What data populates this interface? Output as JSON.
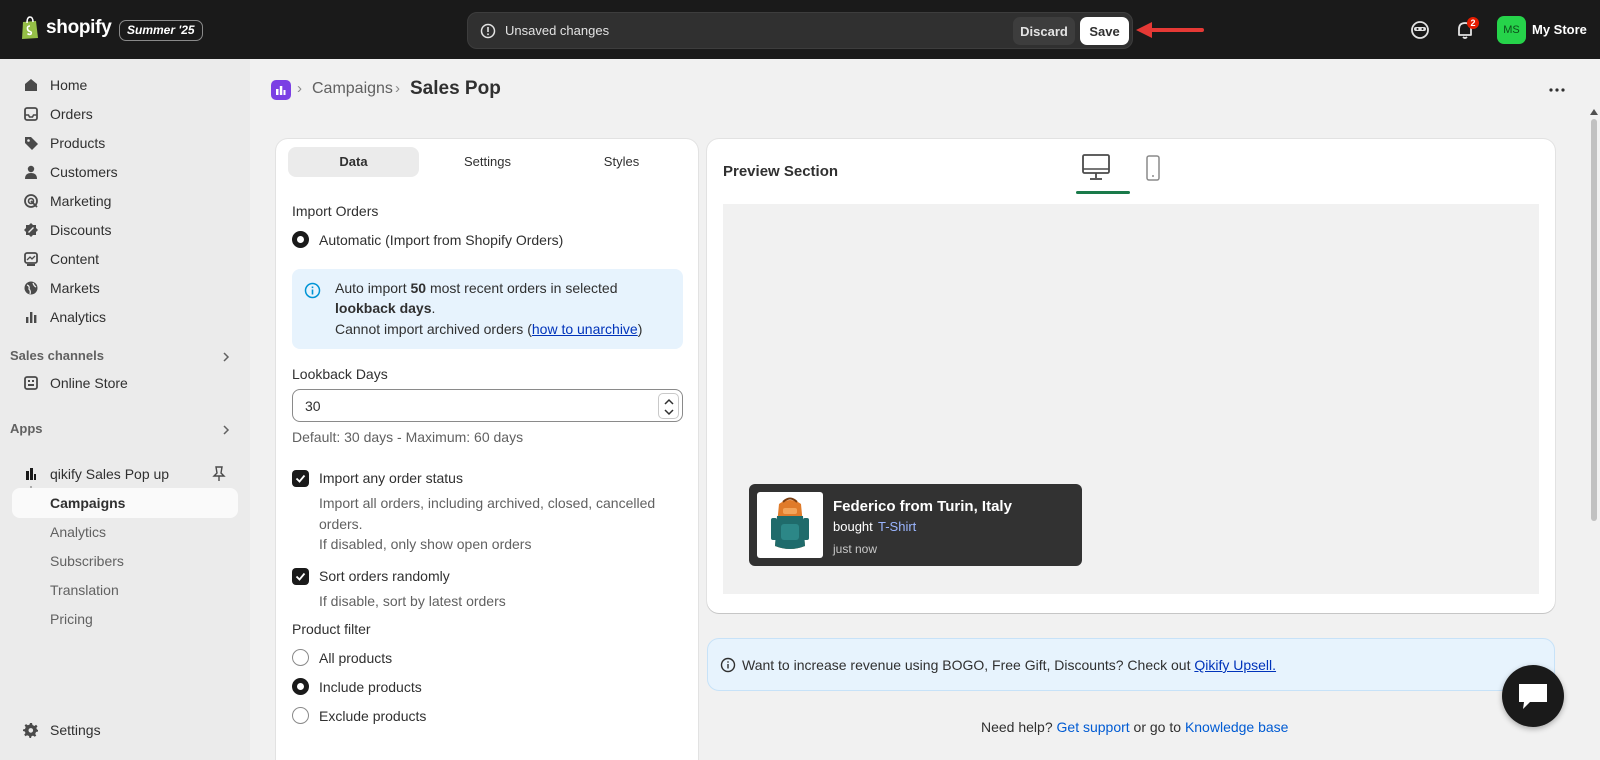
{
  "topbar": {
    "logo_text": "shopify",
    "edition": "Summer '25",
    "unsaved_text": "Unsaved changes",
    "discard_label": "Discard",
    "save_label": "Save",
    "notification_count": "2",
    "avatar_initials": "MS",
    "store_name": "My Store"
  },
  "sidebar": {
    "main_items": [
      {
        "label": "Home",
        "icon": "home-icon"
      },
      {
        "label": "Orders",
        "icon": "orders-icon"
      },
      {
        "label": "Products",
        "icon": "tag-icon"
      },
      {
        "label": "Customers",
        "icon": "person-icon"
      },
      {
        "label": "Marketing",
        "icon": "target-icon"
      },
      {
        "label": "Discounts",
        "icon": "discount-icon"
      },
      {
        "label": "Content",
        "icon": "content-icon"
      },
      {
        "label": "Markets",
        "icon": "globe-icon"
      },
      {
        "label": "Analytics",
        "icon": "bar-chart-icon"
      }
    ],
    "sales_channels_title": "Sales channels",
    "online_store_label": "Online Store",
    "apps_title": "Apps",
    "app_name": "qikify Sales Pop up",
    "app_subitems": [
      "Campaigns",
      "Analytics",
      "Subscribers",
      "Translation",
      "Pricing"
    ],
    "settings_label": "Settings"
  },
  "breadcrumb": {
    "parent": "Campaigns",
    "current": "Sales Pop"
  },
  "tabs": [
    "Data",
    "Settings",
    "Styles"
  ],
  "data_panel": {
    "import_orders_label": "Import Orders",
    "import_option": "Automatic (Import from Shopify Orders)",
    "info_line1_prefix": "Auto import ",
    "info_line1_bold": "50",
    "info_line1_suffix": " most recent orders in selected",
    "info_line2_bold": "lookback days",
    "info_line2_suffix": ".",
    "info_line3_prefix": "Cannot import archived orders (",
    "info_line3_link": "how to unarchive",
    "info_line3_suffix": ")",
    "lookback_label": "Lookback Days",
    "lookback_value": "30",
    "lookback_help": "Default: 30 days - Maximum: 60 days",
    "import_any_status_label": "Import any order status",
    "import_any_status_desc1": "Import all orders, including archived, closed, cancelled",
    "import_any_status_desc2": "orders.",
    "import_any_status_desc3": "If disabled, only show open orders",
    "sort_random_label": "Sort orders randomly",
    "sort_random_desc": "If disable, sort by latest orders",
    "product_filter_label": "Product filter",
    "product_filter_options": [
      "All products",
      "Include products",
      "Exclude products"
    ],
    "product_filter_selected": "Include products"
  },
  "preview": {
    "title": "Preview Section",
    "popup_name": "Federico from Turin, Italy",
    "popup_action": "bought",
    "popup_product": "T-Shirt",
    "popup_time": "just now"
  },
  "banner": {
    "text": "Want to increase revenue using BOGO, Free Gift, Discounts? Check out ",
    "link": "Qikify Upsell."
  },
  "footer": {
    "prefix": "Need help? ",
    "support_link": "Get support",
    "middle": " or go to ",
    "kb_link": "Knowledge base"
  },
  "colors": {
    "topbar_bg": "#1a1a1a",
    "accent_green": "#1a7a4a",
    "link_blue": "#005bd3",
    "info_bg": "#e7f3fd",
    "app_purple": "#7b3fe4"
  }
}
